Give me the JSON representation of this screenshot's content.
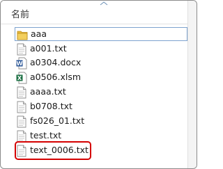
{
  "header": {
    "name_label": "名前"
  },
  "files": [
    {
      "name": "aaa",
      "icon": "folder-icon"
    },
    {
      "name": "a001.txt",
      "icon": "text-file-icon"
    },
    {
      "name": "a0304.docx",
      "icon": "word-doc-icon"
    },
    {
      "name": "a0506.xlsm",
      "icon": "excel-file-icon"
    },
    {
      "name": "aaaa.txt",
      "icon": "text-file-icon"
    },
    {
      "name": "b0708.txt",
      "icon": "text-file-icon"
    },
    {
      "name": "fs026_01.txt",
      "icon": "text-file-icon"
    },
    {
      "name": "test.txt",
      "icon": "text-file-icon"
    },
    {
      "name": "text_0006.txt",
      "icon": "text-file-icon"
    }
  ],
  "colors": {
    "highlight": "#d40000",
    "selection_border": "#7da2ce",
    "folder": "#e8b93a",
    "word": "#2b5797",
    "excel": "#1e7145"
  }
}
